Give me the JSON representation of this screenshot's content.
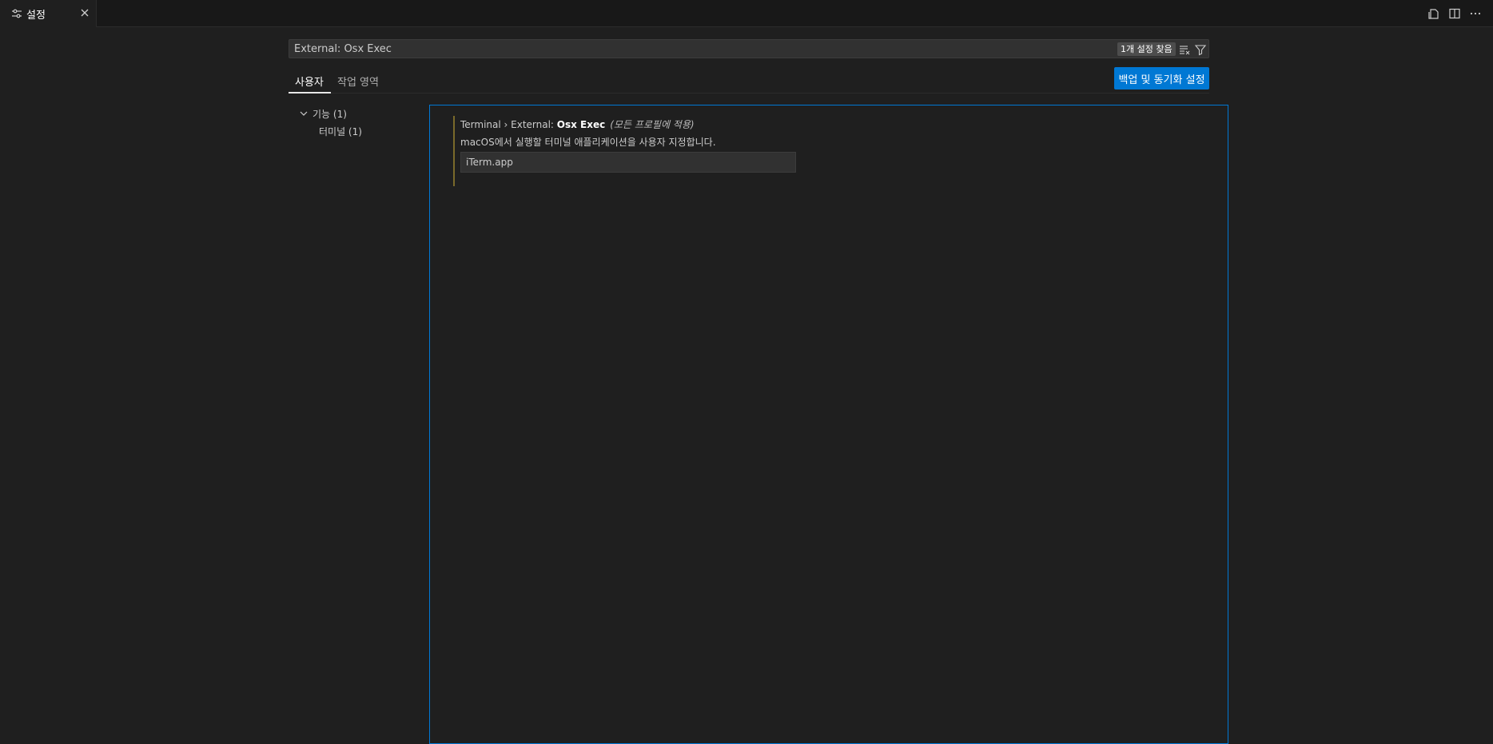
{
  "tab": {
    "title": "설정",
    "icon": "settings-sliders-icon",
    "close_icon": "close-icon"
  },
  "editor_actions": [
    "open-settings-json-icon",
    "split-editor-icon",
    "more-actions-icon"
  ],
  "search": {
    "value": "External: Osx Exec",
    "result_count": "1개 설정 찾음",
    "clear_icon": "clear-filter-icon",
    "filter_icon": "filter-icon"
  },
  "scope_tabs": {
    "user": "사용자",
    "workspace": "작업 영역"
  },
  "sync_button": "백업 및 동기화 설정",
  "toc": {
    "group": "기능 (1)",
    "child": "터미널 (1)"
  },
  "setting": {
    "category": "Terminal › External: ",
    "name": "Osx Exec",
    "scope_note": "(모든 프로필에 적용)",
    "description": "macOS에서 실행할 터미널 애플리케이션을 사용자 지정합니다.",
    "value": "iTerm.app"
  },
  "colors": {
    "accent": "#0078d4",
    "modified_indicator": "#7a6a2a",
    "background": "#1f1f1f"
  }
}
